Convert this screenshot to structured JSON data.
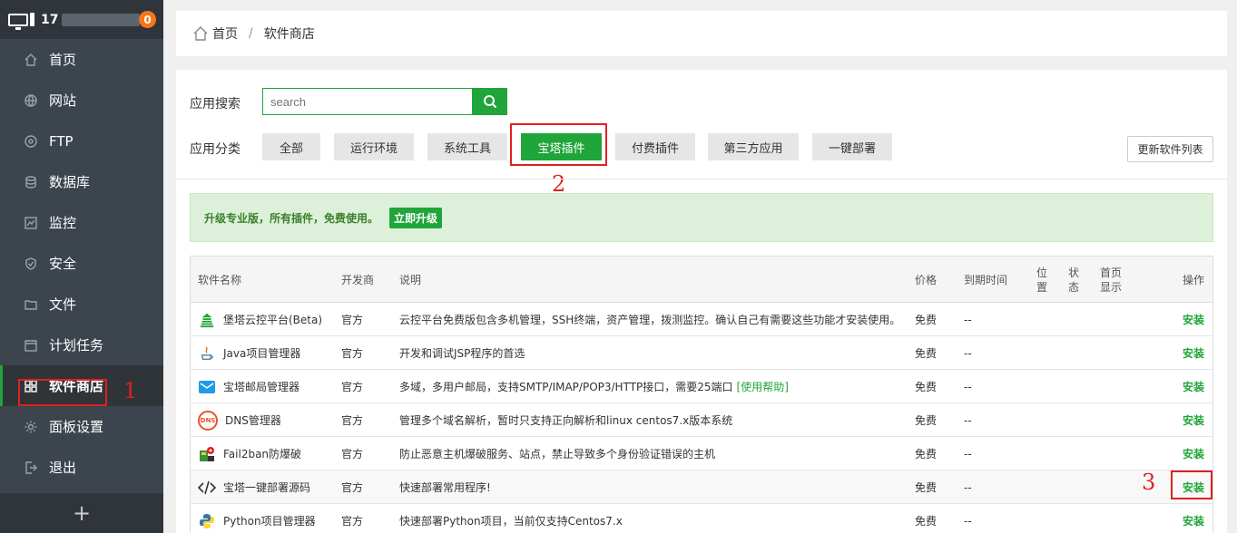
{
  "sidebar": {
    "server_prefix": "17",
    "notification_count": "0",
    "items": [
      {
        "label": "首页",
        "icon": "home-icon"
      },
      {
        "label": "网站",
        "icon": "globe-icon"
      },
      {
        "label": "FTP",
        "icon": "ftp-icon"
      },
      {
        "label": "数据库",
        "icon": "database-icon"
      },
      {
        "label": "监控",
        "icon": "monitor-icon"
      },
      {
        "label": "安全",
        "icon": "shield-icon"
      },
      {
        "label": "文件",
        "icon": "folder-icon"
      },
      {
        "label": "计划任务",
        "icon": "calendar-icon"
      },
      {
        "label": "软件商店",
        "icon": "grid-icon",
        "active": true
      },
      {
        "label": "面板设置",
        "icon": "gear-icon"
      },
      {
        "label": "退出",
        "icon": "logout-icon"
      }
    ],
    "add_label": "+"
  },
  "breadcrumb": {
    "home": "首页",
    "sep": "/",
    "current": "软件商店"
  },
  "search": {
    "label": "应用搜索",
    "placeholder": "search"
  },
  "categories": {
    "label": "应用分类",
    "items": [
      "全部",
      "运行环境",
      "系统工具",
      "宝塔插件",
      "付费插件",
      "第三方应用",
      "一键部署"
    ],
    "active_index": 3
  },
  "refresh_label": "更新软件列表",
  "notice": {
    "text": "升级专业版，所有插件，免费使用。",
    "button": "立即升级"
  },
  "annotations": {
    "one": "1",
    "two": "2",
    "three": "3"
  },
  "table": {
    "headers": {
      "name": "软件名称",
      "developer": "开发商",
      "desc": "说明",
      "price": "价格",
      "expire": "到期时间",
      "position": "位置",
      "status": "状态",
      "homepage": "首页显示",
      "action": "操作"
    },
    "rows": [
      {
        "name": "堡塔云控平台(Beta)",
        "developer": "官方",
        "desc": "云控平台免费版包含多机管理，SSH终端，资产管理，拨测监控。确认自己有需要这些功能才安装使用。",
        "price": "免费",
        "expire": "--",
        "action": "安装",
        "icon": "cloud-control-icon"
      },
      {
        "name": "Java项目管理器",
        "developer": "官方",
        "desc": "开发和调试JSP程序的首选",
        "price": "免费",
        "expire": "--",
        "action": "安装",
        "icon": "java-icon"
      },
      {
        "name": "宝塔邮局管理器",
        "developer": "官方",
        "desc": "多域，多用户邮局，支持SMTP/IMAP/POP3/HTTP接口，需要25端口",
        "help": "[使用帮助]",
        "price": "免费",
        "expire": "--",
        "action": "安装",
        "icon": "mail-icon"
      },
      {
        "name": "DNS管理器",
        "developer": "官方",
        "desc": "管理多个域名解析，暂时只支持正向解析和linux centos7.x版本系统",
        "price": "免费",
        "expire": "--",
        "action": "安装",
        "icon": "dns-icon",
        "icon_text": "DNS"
      },
      {
        "name": "Fail2ban防爆破",
        "developer": "官方",
        "desc": "防止恶意主机爆破服务、站点，禁止导致多个身份验证错误的主机",
        "price": "免费",
        "expire": "--",
        "action": "安装",
        "icon": "fail2ban-icon"
      },
      {
        "name": "宝塔一键部署源码",
        "developer": "官方",
        "desc": "快速部署常用程序!",
        "price": "免费",
        "expire": "--",
        "action": "安装",
        "icon": "code-icon"
      },
      {
        "name": "Python项目管理器",
        "developer": "官方",
        "desc": "快速部署Python项目，当前仅支持Centos7.x",
        "price": "免费",
        "expire": "--",
        "action": "安装",
        "icon": "python-icon"
      }
    ]
  },
  "colors": {
    "accent": "#20a53a",
    "sidebar_bg": "#3c444d",
    "highlight": "#e02020",
    "badge": "#f7761a"
  }
}
